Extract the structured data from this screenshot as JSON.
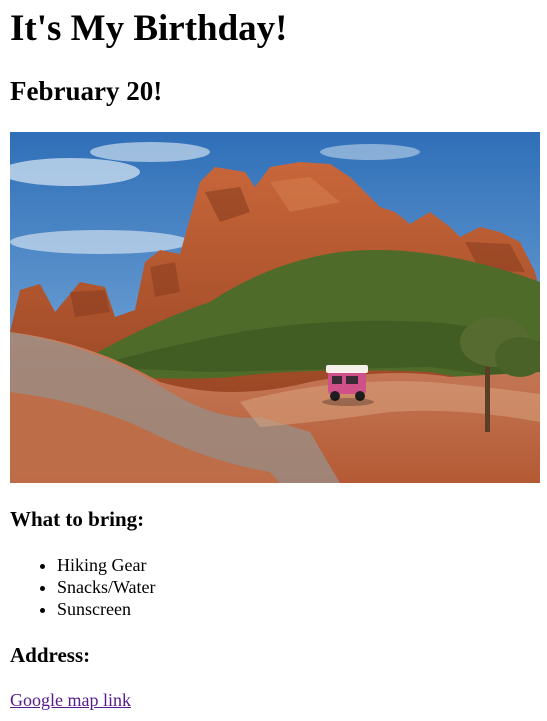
{
  "page": {
    "title": "It's My Birthday!",
    "date": "February 20!"
  },
  "photo": {
    "subject": "red-rock-canyon-jeep-trail-photo",
    "colors": {
      "sky_top": "#2f6fb8",
      "sky_bottom": "#8fbbe3",
      "rock": "#b4532a",
      "rock_dark": "#7e351a",
      "foliage": "#4f6b2a",
      "trail": "#c07a52",
      "slickrock": "#9c8b80",
      "jeep": "#d0508a"
    }
  },
  "bring": {
    "heading": "What to bring:",
    "items": [
      "Hiking Gear",
      "Snacks/Water",
      "Sunscreen"
    ]
  },
  "address": {
    "heading": "Address:",
    "link_text": "Google map link"
  }
}
